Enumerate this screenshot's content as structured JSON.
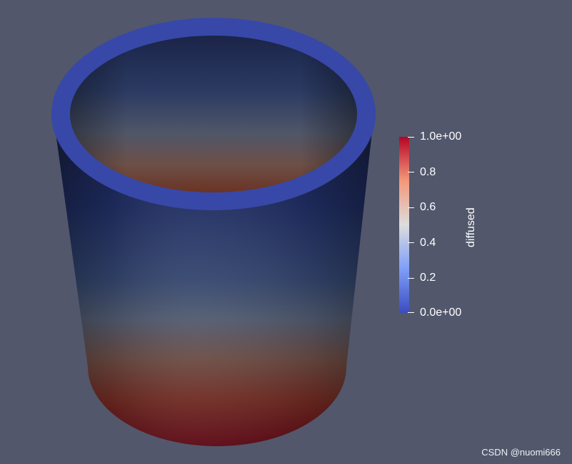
{
  "render": {
    "background_color": "#52576c",
    "scalar_field": "diffused",
    "colormap": "Cool to Warm",
    "colormap_stops": [
      "#3b4cc0",
      "#7f9ef8",
      "#dcdddd",
      "#f4987a",
      "#b40426"
    ]
  },
  "color_legend": {
    "title": "diffused",
    "range": [
      0,
      1
    ],
    "max_label": "1.0e+00",
    "min_label": "0.0e+00",
    "ticks": [
      {
        "value": 0.8,
        "label": "0.8"
      },
      {
        "value": 0.6,
        "label": "0.6"
      },
      {
        "value": 0.4,
        "label": "0.4"
      },
      {
        "value": 0.2,
        "label": "0.2"
      }
    ]
  },
  "watermark": "CSDN @nuomi666"
}
